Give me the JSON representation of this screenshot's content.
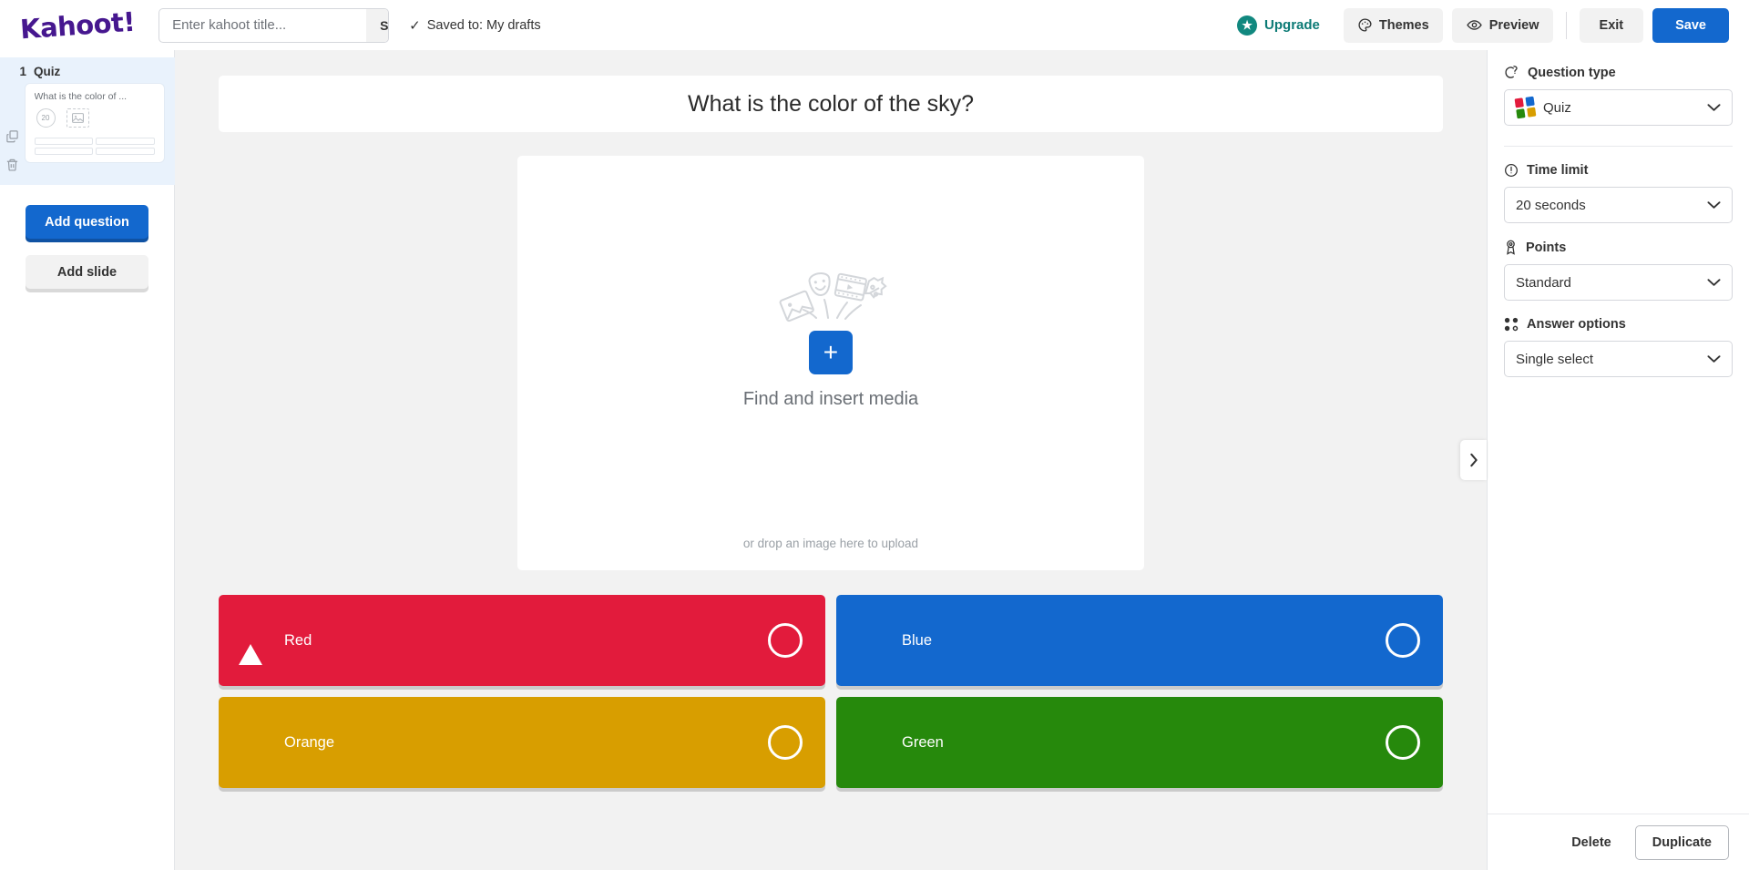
{
  "topbar": {
    "logo": "Kahoot!",
    "title_placeholder": "Enter kahoot title...",
    "title_value": "",
    "settings_label": "Settings",
    "saved_text": "Saved to: My drafts",
    "upgrade_label": "Upgrade",
    "themes_label": "Themes",
    "preview_label": "Preview",
    "exit_label": "Exit",
    "save_label": "Save"
  },
  "sidebar": {
    "question_index": "1",
    "question_type": "Quiz",
    "card_question": "What is the color of ...",
    "card_timer": "20",
    "add_question_label": "Add question",
    "add_slide_label": "Add slide"
  },
  "canvas": {
    "question_text": "What is the color of the sky?",
    "media_label": "Find and insert media",
    "media_drop_text": "or drop an image here to upload",
    "plus_label": "+",
    "answers": [
      {
        "text": "Red",
        "shape": "triangle",
        "color": "#e21b3c",
        "correct": false
      },
      {
        "text": "Blue",
        "shape": "diamond",
        "color": "#1368ce",
        "correct": false
      },
      {
        "text": "Orange",
        "shape": "circle",
        "color": "#d89e00",
        "correct": false
      },
      {
        "text": "Green",
        "shape": "square",
        "color": "#26890c",
        "correct": false
      }
    ]
  },
  "rpanel": {
    "question_type_label": "Question type",
    "question_type_value": "Quiz",
    "time_limit_label": "Time limit",
    "time_limit_value": "20 seconds",
    "points_label": "Points",
    "points_value": "Standard",
    "answer_options_label": "Answer options",
    "answer_options_value": "Single select",
    "delete_label": "Delete",
    "duplicate_label": "Duplicate"
  },
  "colors": {
    "brand_purple": "#46178f",
    "blue": "#1368ce",
    "teal": "#11887f"
  }
}
